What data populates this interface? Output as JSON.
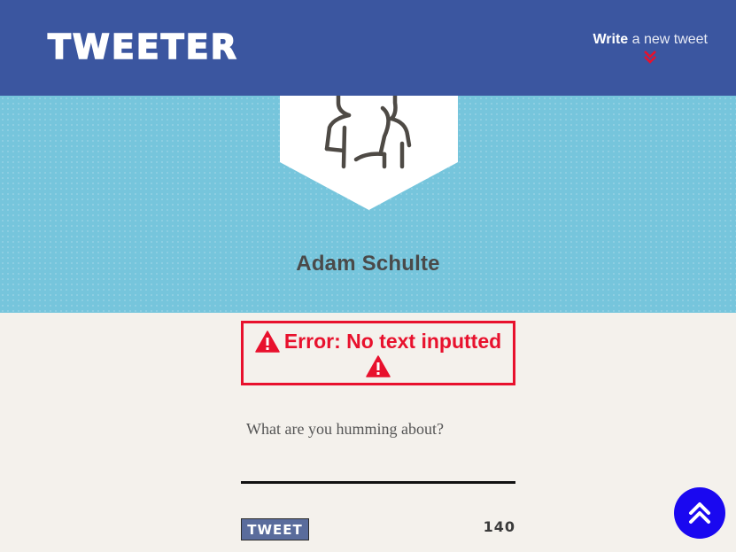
{
  "navbar": {
    "logo_text": "TWEETER",
    "write_bold": "Write",
    "write_rest": " a new tweet",
    "chevron_icon": "double-chevron-down-icon",
    "chevron_color": "#e8112d",
    "background": "#3b56a0"
  },
  "profile": {
    "name": "Adam Schulte",
    "avatar_icon": "person-avatar-icon",
    "banner_color": "#76c5dc"
  },
  "error": {
    "message": "Error: No text inputted",
    "icon": "warning-triangle-icon",
    "color": "#e8112d"
  },
  "compose": {
    "placeholder": "What are you humming about?",
    "value": "",
    "tweet_button_label": "TWEET",
    "char_counter": "140"
  },
  "scroll_top": {
    "icon": "double-chevron-up-icon",
    "color": "#1a08f0"
  }
}
